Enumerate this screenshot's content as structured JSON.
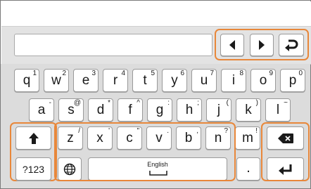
{
  "row1": [
    {
      "main": "q",
      "sub": "1"
    },
    {
      "main": "w",
      "sub": "2"
    },
    {
      "main": "e",
      "sub": "3"
    },
    {
      "main": "r",
      "sub": "4"
    },
    {
      "main": "t",
      "sub": "5"
    },
    {
      "main": "y",
      "sub": "6"
    },
    {
      "main": "u",
      "sub": "7"
    },
    {
      "main": "i",
      "sub": "8"
    },
    {
      "main": "o",
      "sub": "9"
    },
    {
      "main": "p",
      "sub": "0"
    }
  ],
  "row2": [
    {
      "main": "a",
      "sub": "-"
    },
    {
      "main": "s",
      "sub": "@"
    },
    {
      "main": "d",
      "sub": "*"
    },
    {
      "main": "f",
      "sub": "^"
    },
    {
      "main": "g",
      "sub": ":"
    },
    {
      "main": "h",
      "sub": ";"
    },
    {
      "main": "j",
      "sub": "("
    },
    {
      "main": "k",
      "sub": ")"
    },
    {
      "main": "l",
      "sub": "~"
    }
  ],
  "row3": [
    {
      "main": "z",
      "sub": "/"
    },
    {
      "main": "x",
      "sub": "'"
    },
    {
      "main": "c",
      "sub": "\""
    },
    {
      "main": "v",
      "sub": "."
    },
    {
      "main": "b",
      "sub": ","
    },
    {
      "main": "n",
      "sub": "?"
    },
    {
      "main": "m",
      "sub": "!"
    }
  ],
  "bottom": {
    "symbols_label": "?123",
    "space_label": "English",
    "period_label": "."
  },
  "icons": {
    "left_arrow": "arrow-left-icon",
    "right_arrow": "arrow-right-icon",
    "undo": "undo-icon",
    "shift": "shift-icon",
    "backspace": "backspace-icon",
    "enter": "enter-icon",
    "globe": "globe-icon"
  },
  "colors": {
    "highlight": "#e8873a",
    "keyboard_bg": "#dcdcdc",
    "key_bg": "#ffffff"
  }
}
